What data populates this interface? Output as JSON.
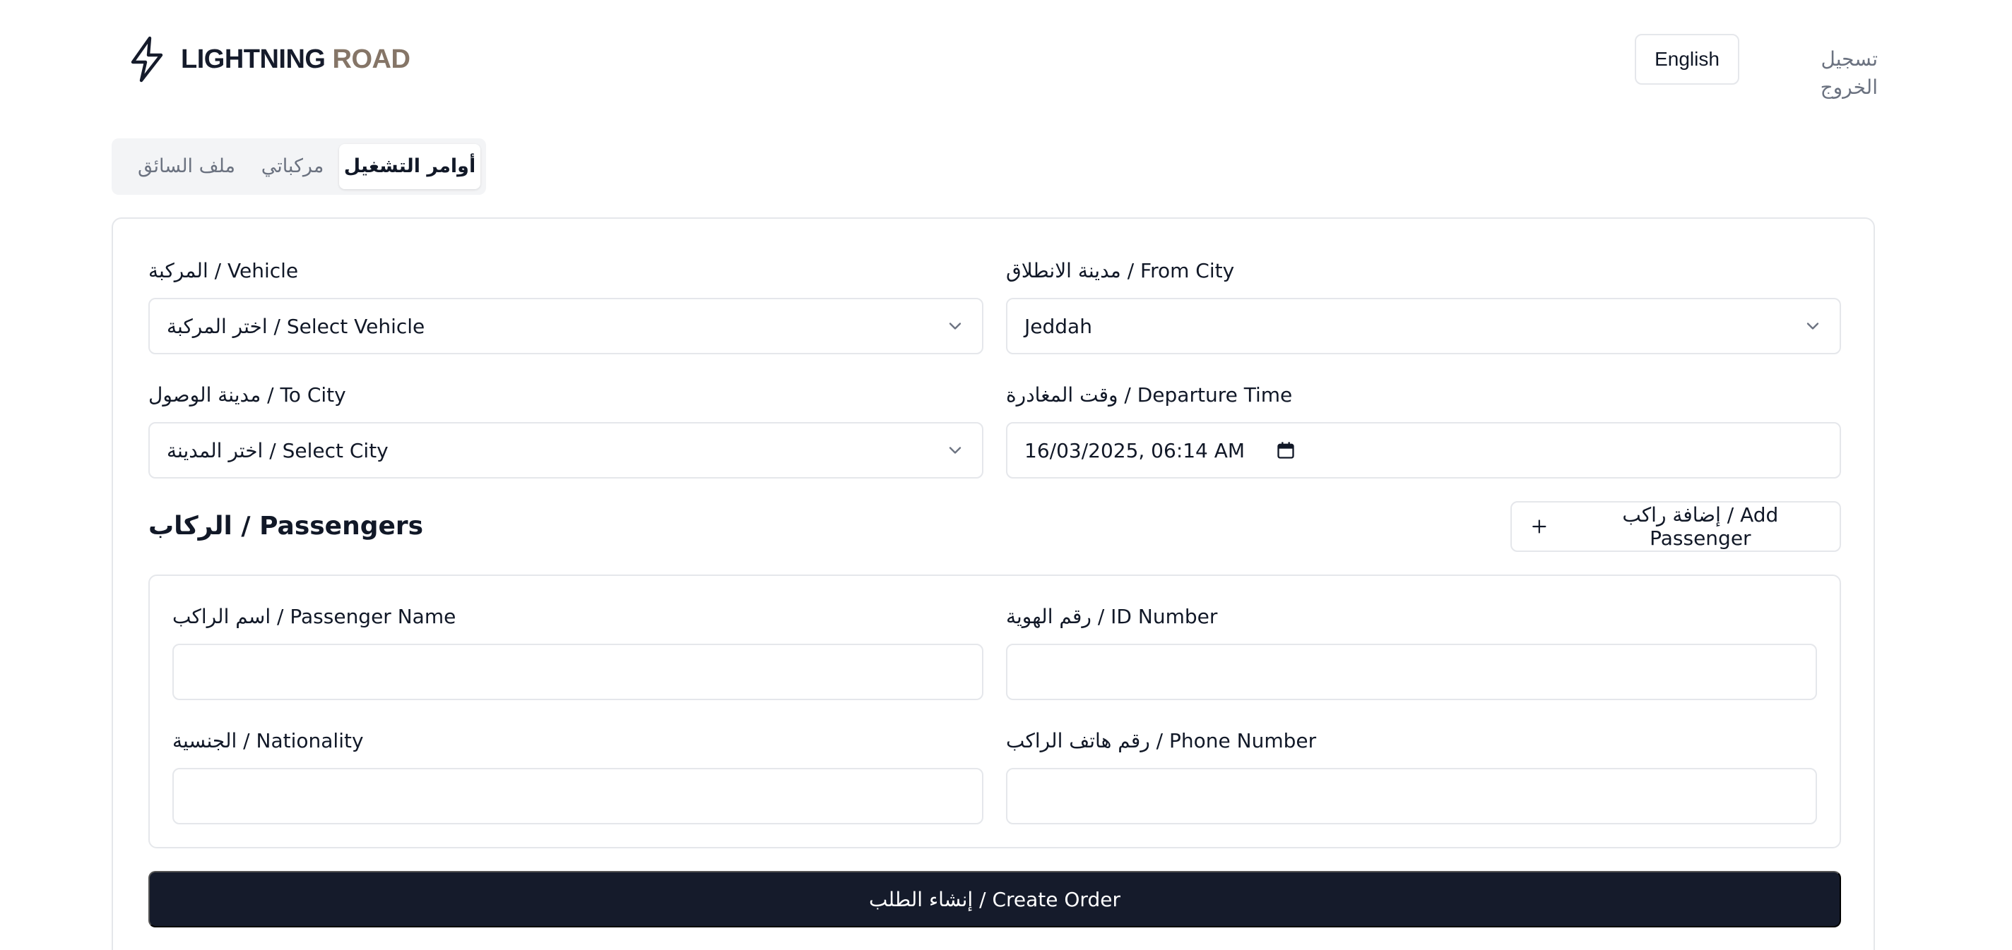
{
  "header": {
    "logo_word1": "LIGHTNING",
    "logo_word2": "ROAD",
    "logo_icon": "lightning-bolt-icon",
    "language_button": "English",
    "logout_link": "تسجيل الخروج"
  },
  "tabs": [
    {
      "label": "أوامر التشغيل",
      "active": true
    },
    {
      "label": "مركباتي",
      "active": false
    },
    {
      "label": "ملف السائق",
      "active": false
    }
  ],
  "form": {
    "from_city_label": "مدينة الانطلاق / From City",
    "from_city_value": "Jeddah",
    "vehicle_label": "المركبة / Vehicle",
    "vehicle_value": "اختر المركبة / Select Vehicle",
    "departure_label": "وقت المغادرة / Departure Time",
    "departure_value": "16/03/2025, 06:14 AM",
    "to_city_label": "مدينة الوصول / To City",
    "to_city_value": "اختر المدينة / Select City"
  },
  "passengers": {
    "title": "الركاب / Passengers",
    "add_button": "إضافة راكب / Add Passenger",
    "id_label": "رقم الهوية / ID Number",
    "name_label": "اسم الراكب / Passenger Name",
    "phone_label": "رقم هاتف الراكب / Phone Number",
    "nationality_label": "الجنسية / Nationality"
  },
  "submit_button": "إنشاء الطلب / Create Order",
  "colors": {
    "brand_dark": "#151b2b",
    "brand_accent": "#857567",
    "border": "#e5e7eb",
    "muted_text": "#6b7280"
  }
}
